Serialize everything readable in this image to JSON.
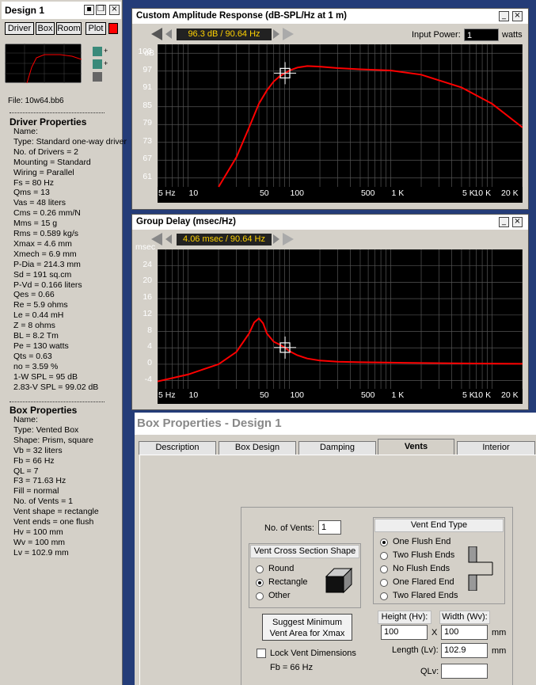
{
  "design_window": {
    "title": "Design 1",
    "tabs": [
      "Driver",
      "Box",
      "Room",
      "Plot"
    ],
    "plot_color": "#ff0000"
  },
  "file_label": "File: 10w64.bb6",
  "driver": {
    "heading": "Driver Properties",
    "props": [
      "Name:",
      "Type: Standard one-way driver",
      "No. of Drivers = 2",
      "Mounting = Standard",
      "Wiring = Parallel",
      "Fs = 80 Hz",
      "Qms = 13",
      "Vas = 48 liters",
      "Cms = 0.26 mm/N",
      "Mms = 15 g",
      "Rms = 0.589 kg/s",
      "Xmax = 4.6 mm",
      "Xmech = 6.9 mm",
      "P-Dia = 214.3 mm",
      "Sd = 191 sq.cm",
      "P-Vd = 0.166 liters",
      "Qes = 0.66",
      "Re = 5.9 ohms",
      "Le = 0.44 mH",
      "Z = 8 ohms",
      "BL = 8.2 Tm",
      "Pe = 130 watts",
      "Qts = 0.63",
      "no = 3.59 %",
      "1-W SPL = 95 dB",
      "2.83-V SPL = 99.02 dB"
    ]
  },
  "box": {
    "heading": "Box Properties",
    "props": [
      "Name:",
      "Type: Vented Box",
      "Shape: Prism, square",
      "Vb = 32 liters",
      "Fb = 66 Hz",
      "QL = 7",
      "F3 = 71.63 Hz",
      "Fill = normal",
      "No. of Vents = 1",
      "Vent shape = rectangle",
      "Vent ends = one flush",
      "Hv = 100 mm",
      "Wv = 100 mm",
      "Lv = 102.9 mm"
    ]
  },
  "amp": {
    "title": "Custom Amplitude Response (dB-SPL/Hz at 1 m)",
    "readout": "96.3 dB / 90.64 Hz",
    "input_power_label": "Input Power:",
    "input_power": "1",
    "input_power_unit": "watts",
    "yunit": "dB",
    "yticks": [
      "103",
      "97",
      "91",
      "85",
      "79",
      "73",
      "67",
      "61"
    ],
    "xticks": [
      "5 Hz",
      "10",
      "50",
      "100",
      "500",
      "1 K",
      "5 K",
      "10 K",
      "20 K"
    ]
  },
  "delay": {
    "title": "Group Delay (msec/Hz)",
    "readout": "4.06 msec / 90.64 Hz",
    "yunit": "msec",
    "yticks": [
      "24",
      "20",
      "16",
      "12",
      "8",
      "4",
      "0",
      "-4"
    ],
    "xticks": [
      "5 Hz",
      "10",
      "50",
      "100",
      "500",
      "1 K",
      "5 K",
      "10 K",
      "20 K"
    ]
  },
  "chart_data": [
    {
      "type": "line",
      "title": "Custom Amplitude Response (dB-SPL/Hz at 1 m)",
      "ylabel": "dB",
      "xscale": "log",
      "xlim": [
        5,
        20000
      ],
      "ylim": [
        58,
        106
      ],
      "series": [
        {
          "x": [
            20,
            30,
            40,
            50,
            60,
            70,
            80,
            90.64,
            100,
            120,
            150,
            200,
            300,
            500,
            1000,
            2000,
            5000,
            10000,
            20000
          ],
          "values": [
            58,
            68,
            78,
            86,
            90.5,
            93.5,
            95.2,
            96.3,
            97.2,
            98.2,
            98.7,
            98.5,
            98,
            97.6,
            97.2,
            95.8,
            91.5,
            86,
            78
          ]
        }
      ],
      "cursor": {
        "x": 90.64,
        "y": 96.3
      },
      "color": "#ff0000"
    },
    {
      "type": "line",
      "title": "Group Delay (msec/Hz)",
      "ylabel": "msec",
      "xscale": "log",
      "xlim": [
        5,
        20000
      ],
      "ylim": [
        -6,
        28
      ],
      "series": [
        {
          "x": [
            5,
            10,
            20,
            30,
            40,
            45,
            50,
            55,
            60,
            70,
            80,
            90.64,
            100,
            120,
            150,
            200,
            300,
            500,
            1000,
            2000,
            5000,
            20000
          ],
          "values": [
            -4.2,
            -2.5,
            0,
            3,
            7.5,
            10.2,
            11.2,
            10,
            7.5,
            5.5,
            4.8,
            4.06,
            3.2,
            2.2,
            1.4,
            0.9,
            0.6,
            0.5,
            0.4,
            0.3,
            0.2,
            0.1
          ]
        }
      ],
      "cursor": {
        "x": 90.64,
        "y": 4.06
      },
      "color": "#ff0000"
    }
  ],
  "boxprops": {
    "title": "Box Properties - Design 1",
    "tabs": [
      "Description",
      "Box Design",
      "Damping",
      "Vents",
      "Interior"
    ],
    "active_tab": "Vents",
    "no_vents_label": "No. of Vents:",
    "no_vents": "1",
    "shape_heading": "Vent Cross Section Shape",
    "shapes": [
      "Round",
      "Rectangle",
      "Other"
    ],
    "shape_selected": "Rectangle",
    "end_heading": "Vent End Type",
    "ends": [
      "One Flush End",
      "Two Flush Ends",
      "No Flush Ends",
      "One Flared End",
      "Two Flared Ends"
    ],
    "end_selected": "One Flush End",
    "suggest_button": "Suggest Minimum Vent Area for Xmax",
    "lock_label": "Lock Vent Dimensions",
    "fb": "Fb = 66 Hz",
    "height_label": "Height (Hv):",
    "height": "100",
    "x": "X",
    "width_label": "Width (Wv):",
    "width": "100",
    "mm": "mm",
    "length_label": "Length (Lv):",
    "length": "102.9",
    "qlv_label": "QLv:",
    "qlv": ""
  }
}
